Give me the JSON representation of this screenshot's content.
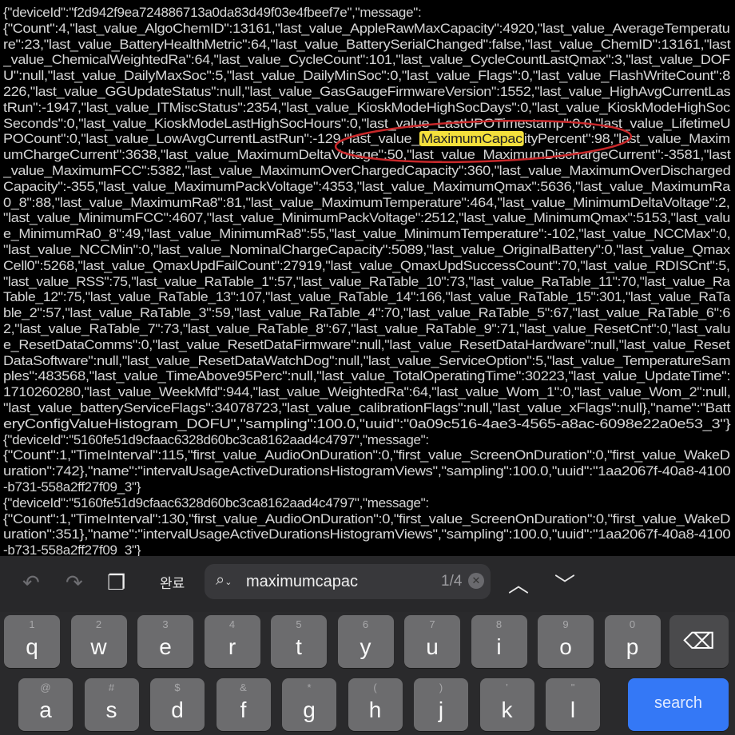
{
  "log": {
    "lines": [
      "{\"deviceId\":\"f2d942f9ea724886713a0da83d49f03e4fbeef7e\",\"message\":",
      "{\"Count\":4,\"last_value_AlgoChemID\":13161,\"last_value_AppleRawMaxCapacity\":4920,\"last_value_AverageTemperatu",
      "re\":23,\"last_value_BatteryHealthMetric\":64,\"last_value_BatterySerialChanged\":false,\"last_value_ChemID\":13161,\"last",
      "_value_ChemicalWeightedRa\":64,\"last_value_CycleCount\":101,\"last_value_CycleCountLastQmax\":3,\"last_value_DOF",
      "U\":null,\"last_value_DailyMaxSoc\":5,\"last_value_DailyMinSoc\":0,\"last_value_Flags\":0,\"last_value_FlashWriteCount\":8",
      "226,\"last_value_GGUpdateStatus\":null,\"last_value_GasGaugeFirmwareVersion\":1552,\"last_value_HighAvgCurrentLas",
      "tRun\":-1947,\"last_value_ITMiscStatus\":2354,\"last_value_KioskModeHighSocDays\":0,\"last_value_KioskModeHighSoc",
      "Seconds\":0,\"last_value_KioskModeLastHighSocHours\":0,\"last_value_LastUPOTimestamp\":0.0,\"last_value_LifetimeU",
      "POCount\":0,\"last_value_LowAvgCurrentLastRun\":-129,\"last_value_",
      "umChargeCurrent\":3638,\"last_value_MaximumDeltaVoltage\":50,\"last_value_MaximumDischargeCurrent\":-3581,\"last",
      "_value_MaximumFCC\":5382,\"last_value_MaximumOverChargedCapacity\":360,\"last_value_MaximumOverDischarged",
      "Capacity\":-355,\"last_value_MaximumPackVoltage\":4353,\"last_value_MaximumQmax\":5636,\"last_value_MaximumRa",
      "0_8\":88,\"last_value_MaximumRa8\":81,\"last_value_MaximumTemperature\":464,\"last_value_MinimumDeltaVoltage\":2,",
      "\"last_value_MinimumFCC\":4607,\"last_value_MinimumPackVoltage\":2512,\"last_value_MinimumQmax\":5153,\"last_valu",
      "e_MinimumRa0_8\":49,\"last_value_MinimumRa8\":55,\"last_value_MinimumTemperature\":-102,\"last_value_NCCMax\":0,",
      "\"last_value_NCCMin\":0,\"last_value_NominalChargeCapacity\":5089,\"last_value_OriginalBattery\":0,\"last_value_Qmax",
      "Cell0\":5268,\"last_value_QmaxUpdFailCount\":27919,\"last_value_QmaxUpdSuccessCount\":70,\"last_value_RDISCnt\":5,",
      "\"last_value_RSS\":75,\"last_value_RaTable_1\":57,\"last_value_RaTable_10\":73,\"last_value_RaTable_11\":70,\"last_value_Ra",
      "Table_12\":75,\"last_value_RaTable_13\":107,\"last_value_RaTable_14\":166,\"last_value_RaTable_15\":301,\"last_value_RaTa",
      "ble_2\":57,\"last_value_RaTable_3\":59,\"last_value_RaTable_4\":70,\"last_value_RaTable_5\":67,\"last_value_RaTable_6\":6",
      "2,\"last_value_RaTable_7\":73,\"last_value_RaTable_8\":67,\"last_value_RaTable_9\":71,\"last_value_ResetCnt\":0,\"last_valu",
      "e_ResetDataComms\":0,\"last_value_ResetDataFirmware\":null,\"last_value_ResetDataHardware\":null,\"last_value_Reset",
      "DataSoftware\":null,\"last_value_ResetDataWatchDog\":null,\"last_value_ServiceOption\":5,\"last_value_TemperatureSam",
      "ples\":483568,\"last_value_TimeAbove95Perc\":null,\"last_value_TotalOperatingTime\":30223,\"last_value_UpdateTime\":",
      "1710260280,\"last_value_WeekMfd\":944,\"last_value_WeightedRa\":64,\"last_value_Wom_1\":0,\"last_value_Wom_2\":null,",
      "\"last_value_batteryServiceFlags\":34078723,\"last_value_calibrationFlags\":null,\"last_value_xFlags\":null},\"name\":\"Batt",
      "eryConfigValueHistogram_DOFU\",\"sampling\":100.0,\"uuid\":\"0a09c516-4ae3-4565-a8ac-6098e22a0e53_3\"}",
      "{\"deviceId\":\"5160fe51d9cfaac6328d60bc3ca8162aad4c4797\",\"message\":",
      "{\"Count\":1,\"TimeInterval\":115,\"first_value_AudioOnDuration\":0,\"first_value_ScreenOnDuration\":0,\"first_value_WakeD",
      "uration\":742},\"name\":\"intervalUsageActiveDurationsHistogramViews\",\"sampling\":100.0,\"uuid\":\"1aa2067f-40a8-4100",
      "-b731-558a2ff27f09_3\"}",
      "{\"deviceId\":\"5160fe51d9cfaac6328d60bc3ca8162aad4c4797\",\"message\":",
      "{\"Count\":1,\"TimeInterval\":130,\"first_value_AudioOnDuration\":0,\"first_value_ScreenOnDuration\":0,\"first_value_WakeD",
      "uration\":351},\"name\":\"intervalUsageActiveDurationsHistogramViews\",\"sampling\":100.0,\"uuid\":\"1aa2067f-40a8-4100",
      "-b731-558a2ff27f09_3\"}"
    ],
    "highlight_line_index": 8,
    "highlight_text": "MaximumCapac",
    "highlight_after": "ityPercent\":98,\"last_value_Maxim",
    "highlight_color": "#f4e03c",
    "annotation_color": "#c8282a"
  },
  "find_bar": {
    "undo_icon": "undo-arrow-icon",
    "redo_icon": "redo-arrow-icon",
    "paste_icon": "clipboard-icon",
    "done_label": "완료",
    "search_icon": "magnifier-dropdown-icon",
    "query": "maximumcapac",
    "match_count": "1/4",
    "clear_icon": "clear-x-icon",
    "prev_icon": "chevron-up-icon",
    "next_icon": "chevron-down-icon"
  },
  "keyboard": {
    "row1": [
      {
        "key": "q",
        "sub": "1"
      },
      {
        "key": "w",
        "sub": "2"
      },
      {
        "key": "e",
        "sub": "3"
      },
      {
        "key": "r",
        "sub": "4"
      },
      {
        "key": "t",
        "sub": "5"
      },
      {
        "key": "y",
        "sub": "6"
      },
      {
        "key": "u",
        "sub": "7"
      },
      {
        "key": "i",
        "sub": "8"
      },
      {
        "key": "o",
        "sub": "9"
      },
      {
        "key": "p",
        "sub": "0"
      }
    ],
    "row2": [
      {
        "key": "a",
        "sub": "@"
      },
      {
        "key": "s",
        "sub": "#"
      },
      {
        "key": "d",
        "sub": "$"
      },
      {
        "key": "f",
        "sub": "&"
      },
      {
        "key": "g",
        "sub": "*"
      },
      {
        "key": "h",
        "sub": "("
      },
      {
        "key": "j",
        "sub": ")"
      },
      {
        "key": "k",
        "sub": "’"
      },
      {
        "key": "l",
        "sub": "\""
      }
    ],
    "backspace_icon": "backspace-icon",
    "search_label": "search",
    "search_color": "#3478f6"
  }
}
